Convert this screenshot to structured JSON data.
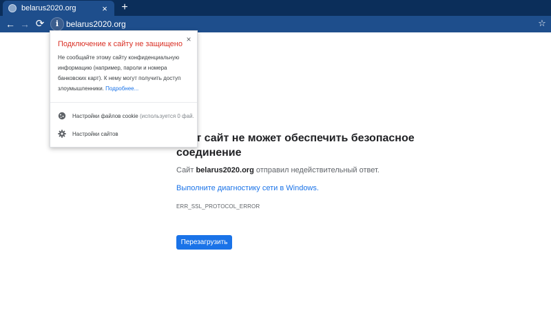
{
  "tab": {
    "title": "belarus2020.org",
    "close_glyph": "×"
  },
  "new_tab_glyph": "+",
  "toolbar": {
    "back_glyph": "←",
    "forward_glyph": "→",
    "reload_glyph": "⟳",
    "info_glyph": "i",
    "url": "belarus2020.org",
    "star_glyph": "☆"
  },
  "popup": {
    "title": "Подключение к сайту не защищено",
    "close_glyph": "×",
    "body": "Не сообщайте этому сайту конфиденциальную информацию (например, пароли и номера банковских карт). К нему могут получить доступ злоумышленники.",
    "more_link": "Подробнее...",
    "cookie_label": "Настройки файлов cookie",
    "cookie_hint": "(используется 0 фай.",
    "sites_label": "Настройки сайтов"
  },
  "error": {
    "title": "Этот сайт не может обеспечить безопасное соединение",
    "desc_prefix": "Сайт",
    "desc_site": "belarus2020.org",
    "desc_suffix": "отправил недействительный ответ.",
    "diagnostics_link": "Выполните диагностику сети в Windows.",
    "code": "ERR_SSL_PROTOCOL_ERROR",
    "reload_button": "Перезагрузить"
  },
  "colors": {
    "tab_strip": "#0b2e5a",
    "toolbar": "#1e4e8c",
    "warning": "#d93025",
    "link": "#1a73e8",
    "button": "#1a73e8"
  },
  "icons": {
    "favicon": "globe-icon",
    "cookie": "cookie-icon",
    "sites": "gear-icon",
    "info": "info-icon",
    "bookmark": "star-icon"
  }
}
